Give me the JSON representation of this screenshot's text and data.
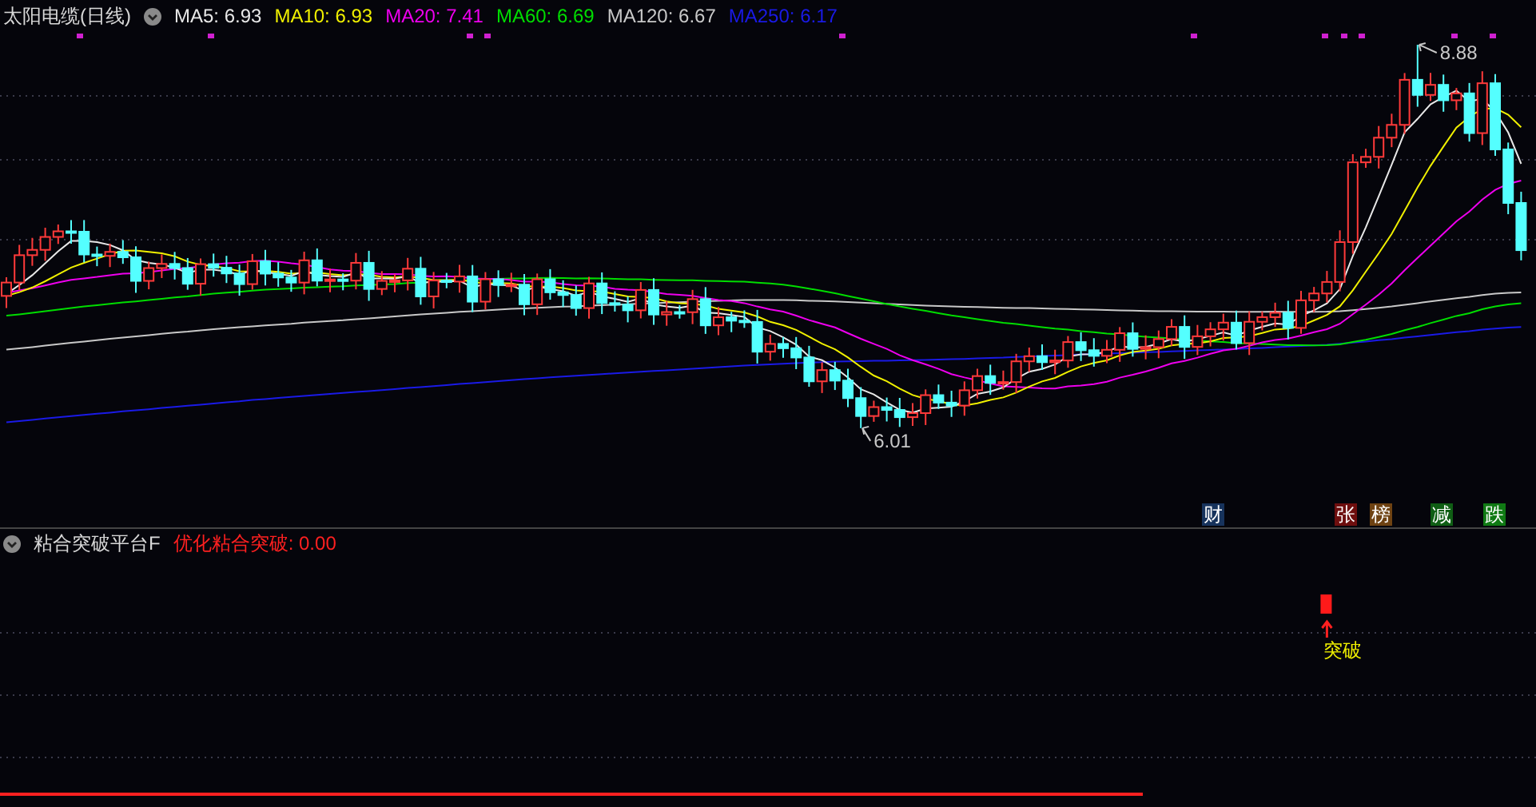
{
  "chart_title": "太阳电缆(日线)",
  "ma_legend": [
    {
      "label": "MA5: 6.93",
      "color": "#e8e8e8"
    },
    {
      "label": "MA10: 6.93",
      "color": "#f0f000"
    },
    {
      "label": "MA20: 7.41",
      "color": "#ee00ee"
    },
    {
      "label": "MA60: 6.69",
      "color": "#00dd00"
    },
    {
      "label": "MA120: 6.67",
      "color": "#c8c8c8"
    },
    {
      "label": "MA250: 6.17",
      "color": "#1a1ae6"
    }
  ],
  "price_labels": [
    {
      "kind": "high",
      "text": "8.88"
    },
    {
      "kind": "low",
      "text": "6.01"
    }
  ],
  "events": [
    {
      "label": "财",
      "color": "#17335c"
    },
    {
      "label": "张",
      "color": "#6e0e0e"
    },
    {
      "label": "榜",
      "color": "#6e4212"
    },
    {
      "label": "减",
      "color": "#0f5e14"
    },
    {
      "label": "跌",
      "color": "#107a14"
    }
  ],
  "indicator": {
    "title": "粘合突破平台F",
    "reading": "优化粘合突破: 0.00",
    "signal": "突破"
  }
}
